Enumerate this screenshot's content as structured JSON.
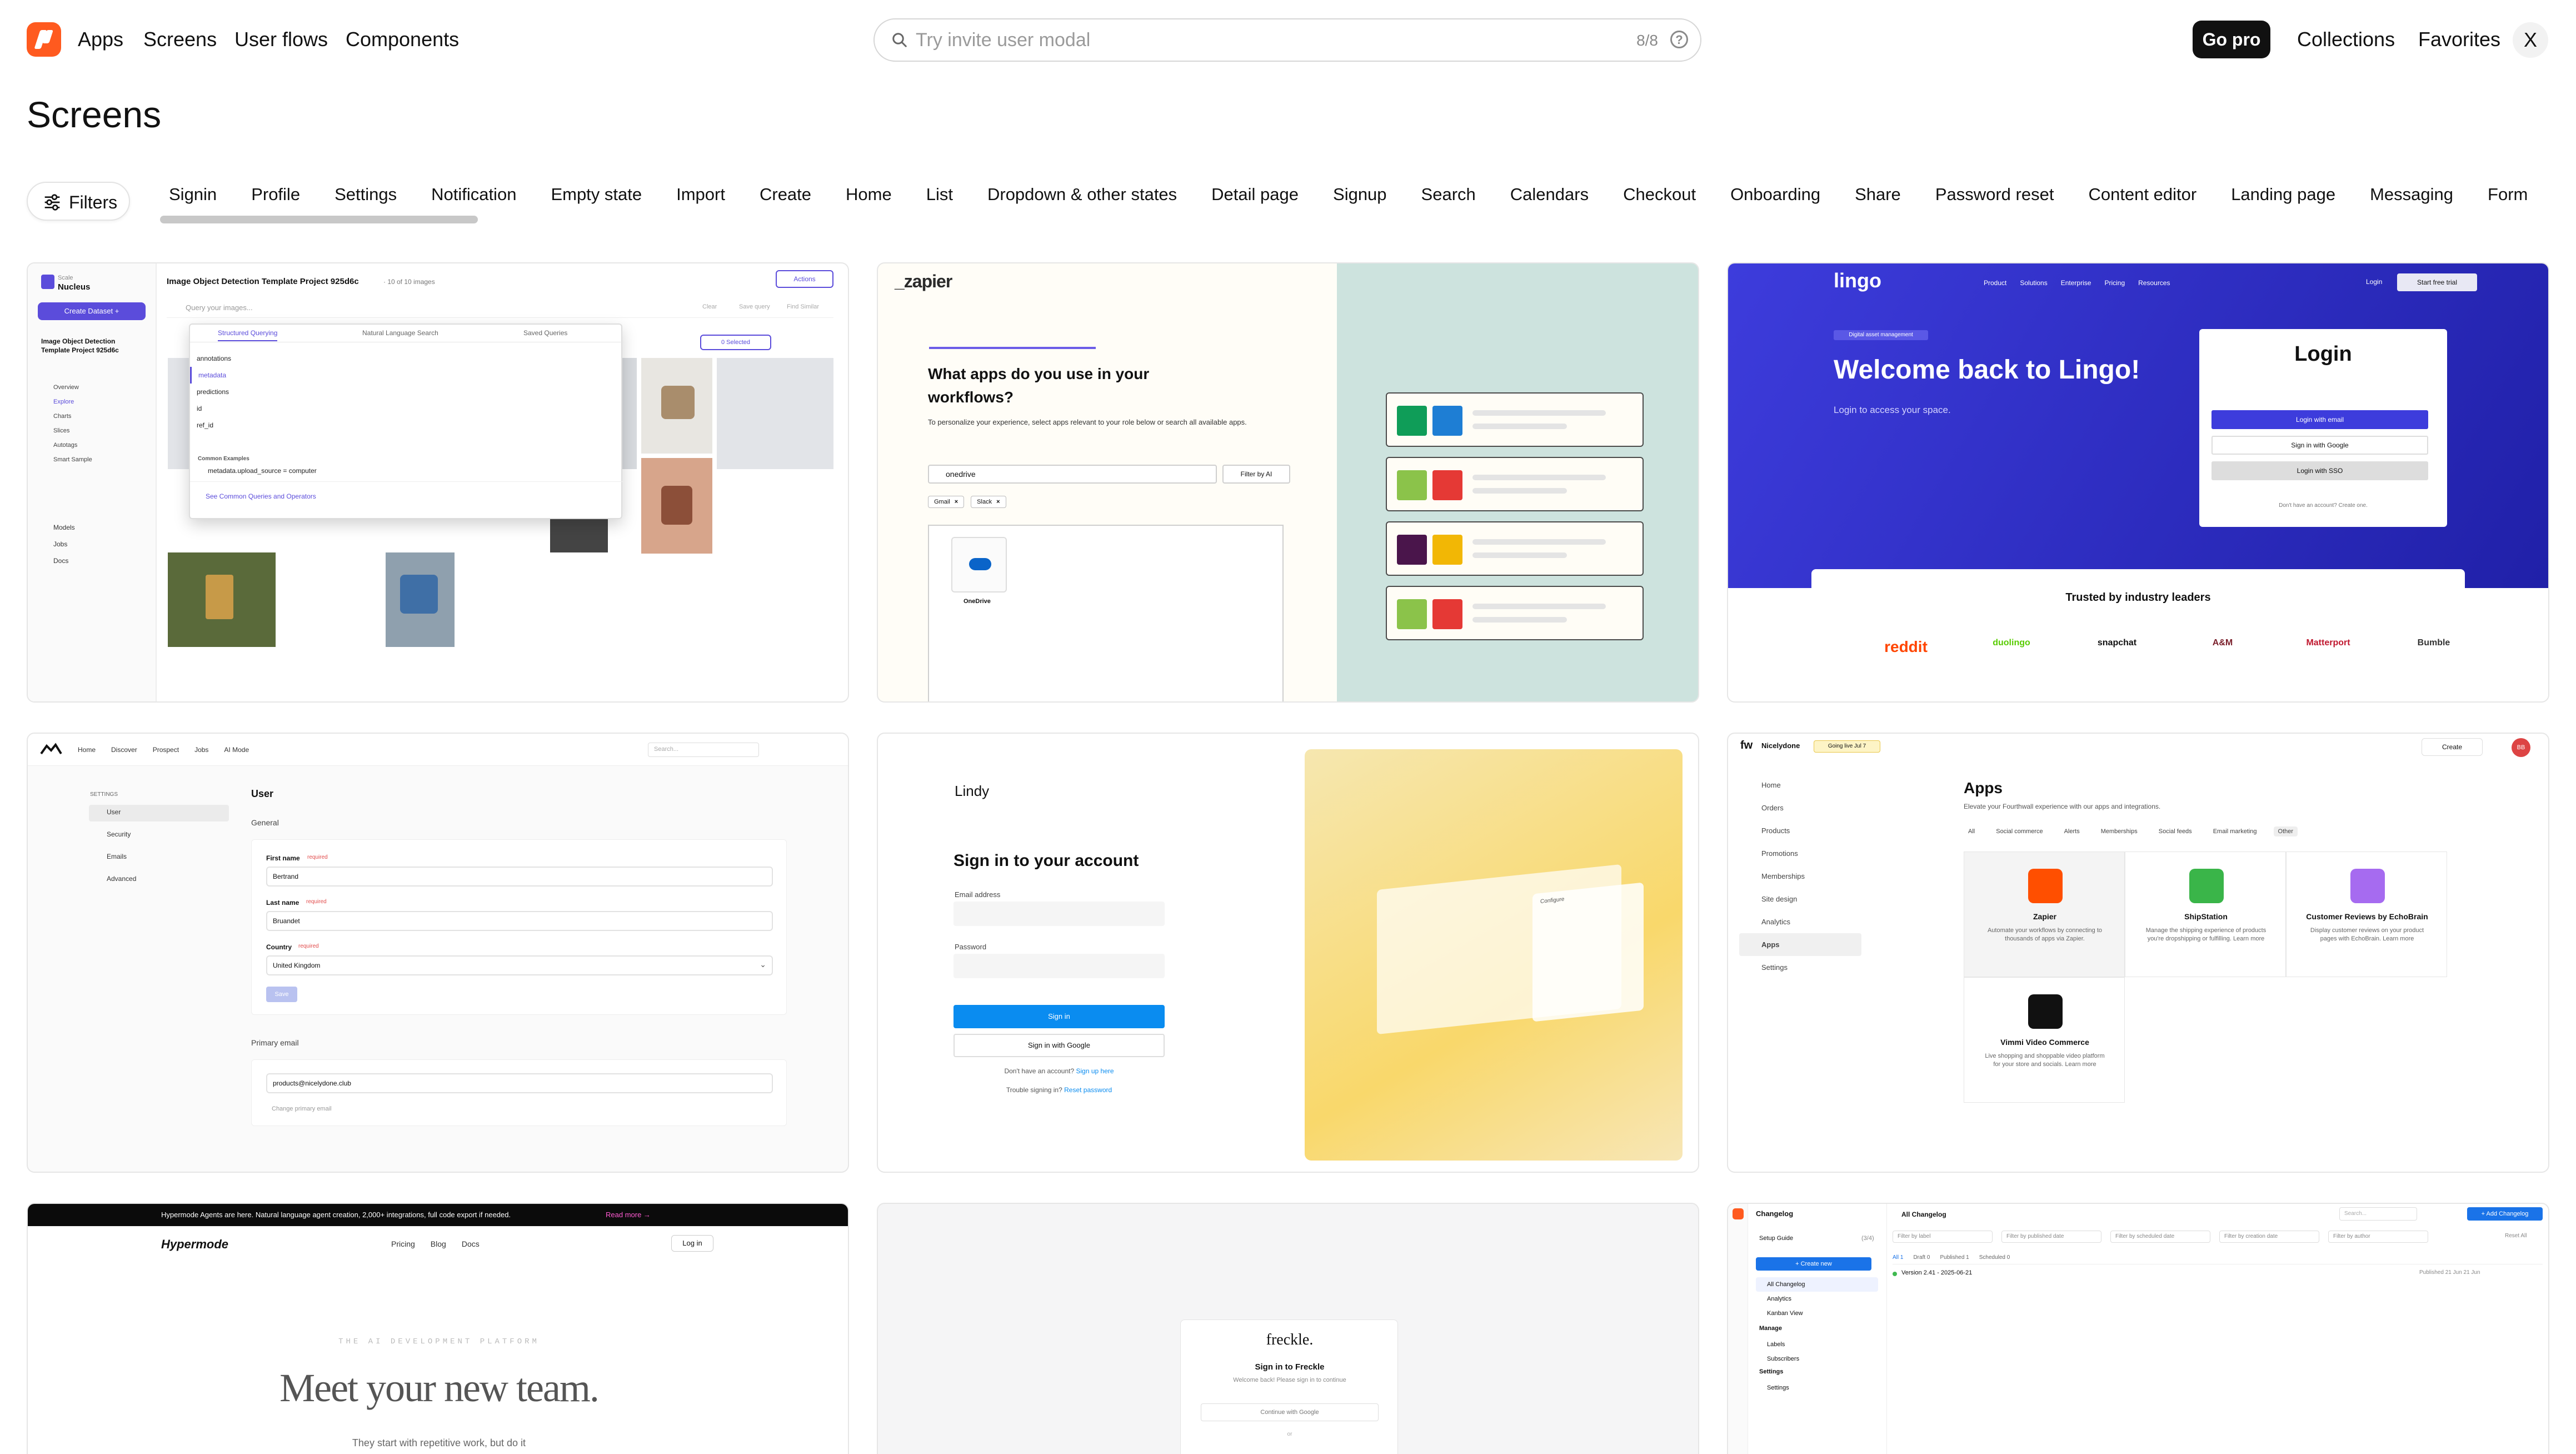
{
  "nav": {
    "links": [
      "Apps",
      "Screens",
      "User flows",
      "Components"
    ],
    "search_placeholder": "Try invite user modal",
    "search_count": "8/8",
    "help": "?",
    "go_pro": "Go pro",
    "collections": "Collections",
    "favorites": "Favorites",
    "close": "X"
  },
  "page": {
    "title": "Screens"
  },
  "filters": {
    "label": "Filters"
  },
  "categories": [
    "Signin",
    "Profile",
    "Settings",
    "Notification",
    "Empty state",
    "Import",
    "Create",
    "Home",
    "List",
    "Dropdown & other states",
    "Detail page",
    "Signup",
    "Search",
    "Calendars",
    "Checkout",
    "Onboarding",
    "Share",
    "Password reset",
    "Content editor",
    "Landing page",
    "Messaging",
    "Form"
  ],
  "cards": {
    "nucleus": {
      "brand_small": "Scale",
      "brand": "Nucleus",
      "create_dataset": "Create Dataset +",
      "project_title": "Image Object Detection Template Project 925d6c",
      "project_meta": "· 10 of 10 images",
      "actions": "Actions",
      "query_placeholder": "Query your images...",
      "clear": "Clear",
      "save_query": "Save query",
      "find_similar": "Find Similar",
      "tabs": [
        "Structured Querying",
        "Natural Language Search",
        "Saved Queries"
      ],
      "selected": "0 Selected",
      "options": [
        "annotations",
        "metadata",
        "predictions",
        "id",
        "ref_id"
      ],
      "common_examples": "Common Examples",
      "example_query": "metadata.upload_source = computer",
      "see_common": "See Common Queries and Operators",
      "side_project": "Image Object Detection Template Project 925d6c",
      "side_items": [
        "Overview",
        "Explore",
        "Charts",
        "Slices",
        "Autotags",
        "Smart Sample"
      ],
      "side_bottom": [
        "Models",
        "Jobs",
        "Docs"
      ]
    },
    "zapier": {
      "logo": "_zapier",
      "question": "What apps do you use in your workflows?",
      "subtitle": "To personalize your experience, select apps relevant to your role below or search all available apps.",
      "search_value": "onedrive",
      "filter_ai": "Filter by AI",
      "chips": [
        "Gmail",
        "Slack"
      ],
      "app_name": "OneDrive",
      "tile_colors": [
        [
          "#0f9d58",
          "#1e7ed4"
        ],
        [
          "#8bc34a",
          "#e53935"
        ],
        [
          "#4a154b",
          "#f2b705"
        ],
        [
          "#8bc34a",
          "#e53935"
        ]
      ]
    },
    "lingo": {
      "logo": "lingo",
      "menu": [
        "Product",
        "Solutions",
        "Enterprise",
        "Pricing",
        "Resources"
      ],
      "login_link": "Login",
      "start_trial": "Start free trial",
      "badge": "Digital asset management",
      "headline": "Welcome back to Lingo!",
      "subline": "Login to access your space.",
      "login_title": "Login",
      "login_email": "Login with email",
      "signin_google": "Sign in with Google",
      "login_sso": "Login with SSO",
      "no_account": "Don't have an account? Create one.",
      "trusted": "Trusted by industry leaders",
      "logos": [
        "reddit",
        "duolingo",
        "snapchat",
        "A&M",
        "Matterport",
        "Bumble"
      ]
    },
    "settings": {
      "nav": [
        "Home",
        "Discover",
        "Prospect",
        "Jobs",
        "AI Mode"
      ],
      "search_placeholder": "Search...",
      "section": "SETTINGS",
      "menu": [
        "User",
        "Security",
        "Emails",
        "Advanced"
      ],
      "heading": "User",
      "general": "General",
      "first_name_label": "First name",
      "required": "required",
      "first_name": "Bertrand",
      "last_name_label": "Last name",
      "last_name": "Bruandet",
      "country_label": "Country",
      "country": "United Kingdom",
      "save": "Save",
      "primary_email_label": "Primary email",
      "email": "products@nicelydone.club",
      "change_email": "Change primary email"
    },
    "lindy": {
      "logo": "Lindy",
      "title": "Sign in to your account",
      "email_label": "Email address",
      "password_label": "Password",
      "sign_in": "Sign in",
      "google": "Sign in with Google",
      "no_account": "Don't have an account?",
      "sign_up": "Sign up here",
      "trouble": "Trouble signing in?",
      "reset": "Reset password",
      "mock_label": "Configure"
    },
    "apps": {
      "brand": "Nicelydone",
      "badge": "Going live Jul 7",
      "create": "Create",
      "avatar": "BB",
      "nav": [
        "Home",
        "Orders",
        "Products",
        "Promotions",
        "Memberships",
        "Site design",
        "Analytics",
        "Apps",
        "Settings"
      ],
      "title": "Apps",
      "subtitle": "Elevate your Fourthwall experience with our apps and integrations.",
      "filters": [
        "All",
        "Social commerce",
        "Alerts",
        "Memberships",
        "Social feeds",
        "Email marketing",
        "Other"
      ],
      "apps": [
        {
          "name": "Zapier",
          "desc": "Automate your workflows by connecting to thousands of apps via Zapier.",
          "color": "#ff4f00"
        },
        {
          "name": "ShipStation",
          "desc": "Manage the shipping experience of products you're dropshipping or fulfilling. Learn more",
          "color": "#3ab549"
        },
        {
          "name": "Customer Reviews by EchoBrain",
          "desc": "Display customer reviews on your product pages with EchoBrain. Learn more",
          "color": "#a66bf0"
        },
        {
          "name": "Vimmi Video Commerce",
          "desc": "Live shopping and shoppable video platform for your store and socials. Learn more",
          "color": "#111111"
        }
      ]
    },
    "hypermode": {
      "banner": "Hypermode Agents are here. Natural language agent creation, 2,000+ integrations, full code export if needed.",
      "read_more": "Read more →",
      "logo": "Hypermode",
      "links": [
        "Pricing",
        "Blog",
        "Docs"
      ],
      "login": "Log in",
      "eyebrow": "THE AI DEVELOPMENT PLATFORM",
      "headline": "Meet your new team.",
      "sub": "They start with repetitive work, but do it"
    },
    "freckle": {
      "logo": "freckle.",
      "title": "Sign in to Freckle",
      "sub": "Welcome back! Please sign in to continue",
      "google": "Continue with Google",
      "or": "or"
    },
    "changelog": {
      "sidebar_title": "Changelog",
      "setup": "Setup Guide",
      "setup_count": "(3/4)",
      "create_new": "+ Create new",
      "items": [
        "All Changelog",
        "Analytics",
        "Kanban View"
      ],
      "manage": "Manage",
      "manage_items": [
        "Labels",
        "Subscribers"
      ],
      "settings": "Settings",
      "settings_items": [
        "Settings"
      ],
      "header": "All Changelog",
      "search": "Search...",
      "add": "+ Add Changelog",
      "filters": [
        "Filter by label",
        "Filter by published date",
        "Filter by scheduled date",
        "Filter by creation date",
        "Filter by author"
      ],
      "reset": "Reset All",
      "tabs": [
        "All 1",
        "Draft 0",
        "Published 1",
        "Scheduled 0"
      ],
      "entry": "Version 2.41 - 2025-06-21",
      "entry_meta": "Published 21 Jun  21 Jun"
    }
  }
}
